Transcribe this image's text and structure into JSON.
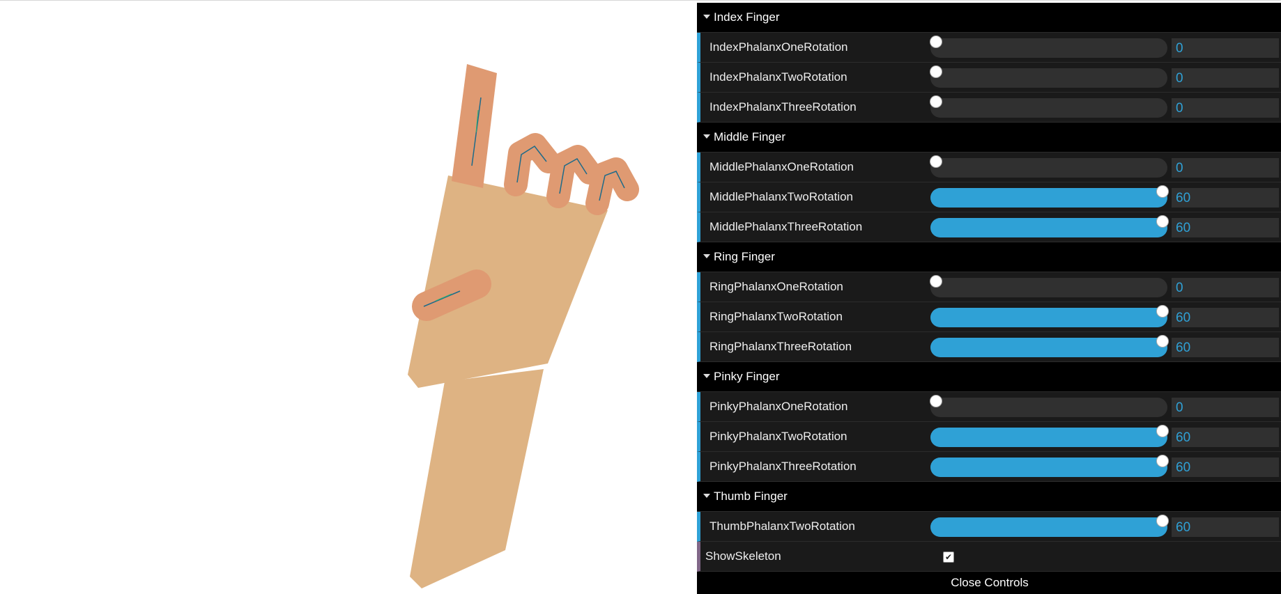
{
  "colors": {
    "accent": "#2fa1d6",
    "bool_accent": "#806787",
    "palm": "#deb383",
    "finger": "#df9a72"
  },
  "gui": {
    "folders": [
      {
        "title": "Index Finger",
        "controls": [
          {
            "label": "IndexPhalanxOneRotation",
            "value": "0",
            "fraction": 0
          },
          {
            "label": "IndexPhalanxTwoRotation",
            "value": "0",
            "fraction": 0
          },
          {
            "label": "IndexPhalanxThreeRotation",
            "value": "0",
            "fraction": 0
          }
        ]
      },
      {
        "title": "Middle Finger",
        "controls": [
          {
            "label": "MiddlePhalanxOneRotation",
            "value": "0",
            "fraction": 0
          },
          {
            "label": "MiddlePhalanxTwoRotation",
            "value": "60",
            "fraction": 1
          },
          {
            "label": "MiddlePhalanxThreeRotation",
            "value": "60",
            "fraction": 1
          }
        ]
      },
      {
        "title": "Ring Finger",
        "controls": [
          {
            "label": "RingPhalanxOneRotation",
            "value": "0",
            "fraction": 0
          },
          {
            "label": "RingPhalanxTwoRotation",
            "value": "60",
            "fraction": 1
          },
          {
            "label": "RingPhalanxThreeRotation",
            "value": "60",
            "fraction": 1
          }
        ]
      },
      {
        "title": "Pinky Finger",
        "controls": [
          {
            "label": "PinkyPhalanxOneRotation",
            "value": "0",
            "fraction": 0
          },
          {
            "label": "PinkyPhalanxTwoRotation",
            "value": "60",
            "fraction": 1
          },
          {
            "label": "PinkyPhalanxThreeRotation",
            "value": "60",
            "fraction": 1
          }
        ]
      },
      {
        "title": "Thumb Finger",
        "controls": [
          {
            "label": "ThumbPhalanxTwoRotation",
            "value": "60",
            "fraction": 1
          }
        ]
      }
    ],
    "show_skeleton": {
      "label": "ShowSkeleton",
      "checked": true
    },
    "close_label": "Close Controls"
  }
}
